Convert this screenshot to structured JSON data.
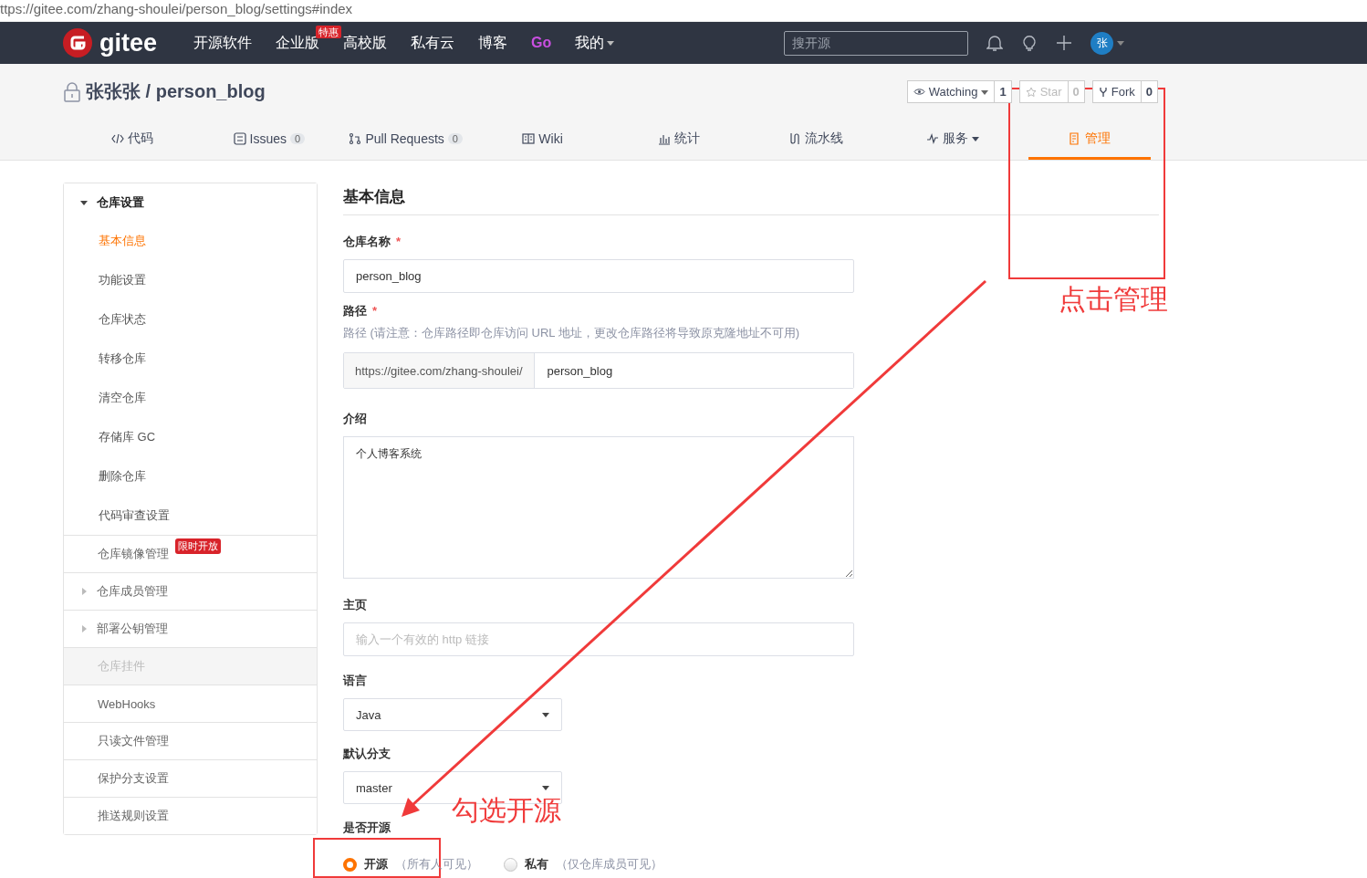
{
  "address_bar": {
    "url": "ttps://gitee.com/zhang-shoulei/person_blog/settings#index"
  },
  "navbar": {
    "logo": "gitee",
    "items": [
      {
        "label": "开源软件",
        "kind": "text"
      },
      {
        "label": "企业版",
        "kind": "text",
        "badge": "特惠"
      },
      {
        "label": "高校版",
        "kind": "text"
      },
      {
        "label": "私有云",
        "kind": "text"
      },
      {
        "label": "博客",
        "kind": "text"
      },
      {
        "label": "Go",
        "kind": "brand"
      },
      {
        "label": "我的",
        "kind": "menu"
      }
    ],
    "search": {
      "placeholder": "搜开源"
    },
    "avatar": "张"
  },
  "repo": {
    "owner": "张张张",
    "separator": "/",
    "name": "person_blog",
    "buttons": [
      {
        "label": "Watching",
        "count": "1",
        "disabled": false,
        "kind": "watch"
      },
      {
        "label": "Star",
        "count": "0",
        "disabled": true,
        "kind": "star"
      },
      {
        "label": "Fork",
        "count": "0",
        "disabled": false,
        "kind": "fork"
      }
    ],
    "tabs": [
      {
        "label": "代码",
        "selected": false
      },
      {
        "label": "Issues",
        "count": "0",
        "selected": false
      },
      {
        "label": "Pull Requests",
        "count": "0",
        "selected": false
      },
      {
        "label": "Wiki",
        "selected": false
      },
      {
        "label": "统计",
        "selected": false
      },
      {
        "label": "流水线",
        "selected": false
      },
      {
        "label": "服务",
        "dropdown": true,
        "selected": false
      },
      {
        "label": "管理",
        "selected": true
      }
    ]
  },
  "sidebar": {
    "items": [
      {
        "label": "仓库设置",
        "kind": "group",
        "expanded": true,
        "selected": false,
        "disabled": false,
        "children": [
          {
            "label": "基本信息",
            "selected": true
          },
          {
            "label": "功能设置",
            "selected": false
          },
          {
            "label": "仓库状态",
            "selected": false
          },
          {
            "label": "转移仓库",
            "selected": false
          },
          {
            "label": "清空仓库",
            "selected": false
          },
          {
            "label": "存储库 GC",
            "selected": false
          },
          {
            "label": "删除仓库",
            "selected": false
          },
          {
            "label": "代码审查设置",
            "selected": false
          }
        ]
      },
      {
        "label": "仓库镜像管理",
        "kind": "item",
        "badge": "限时开放",
        "selected": false,
        "disabled": false
      },
      {
        "label": "仓库成员管理",
        "kind": "group",
        "expanded": false,
        "selected": false,
        "disabled": false
      },
      {
        "label": "部署公钥管理",
        "kind": "group",
        "expanded": false,
        "selected": false,
        "disabled": false
      },
      {
        "label": "仓库挂件",
        "kind": "item",
        "selected": false,
        "disabled": true
      },
      {
        "label": "WebHooks",
        "kind": "item",
        "selected": false,
        "disabled": false
      },
      {
        "label": "只读文件管理",
        "kind": "item",
        "selected": false,
        "disabled": false
      },
      {
        "label": "保护分支设置",
        "kind": "item",
        "selected": false,
        "disabled": false
      },
      {
        "label": "推送规则设置",
        "kind": "item",
        "selected": false,
        "disabled": false
      }
    ]
  },
  "form": {
    "title": "基本信息",
    "fields": [
      {
        "kind": "input",
        "label": "仓库名称",
        "required_mark": "*",
        "value": "person_blog"
      },
      {
        "kind": "prefixed",
        "label": "路径",
        "required_mark": "*",
        "hint": "路径 (请注意：仓库路径即仓库访问 URL 地址，更改仓库路径将导致原克隆地址不可用)",
        "prefix": "https://gitee.com/zhang-shoulei/",
        "value": "person_blog"
      },
      {
        "kind": "textarea",
        "label": "介绍",
        "value": "个人博客系统"
      },
      {
        "kind": "input",
        "label": "主页",
        "placeholder": "输入一个有效的 http 链接"
      },
      {
        "kind": "select",
        "label": "语言",
        "value": "Java"
      },
      {
        "kind": "select",
        "label": "默认分支",
        "value": "master"
      },
      {
        "kind": "radio",
        "label": "是否开源",
        "options": [
          {
            "label": "开源",
            "note": "（所有人可见）",
            "selected": true
          },
          {
            "label": "私有",
            "note": "（仅仓库成员可见）",
            "selected": false
          }
        ]
      }
    ]
  },
  "annotations": [
    {
      "text": "点击管理"
    },
    {
      "text": "勾选开源"
    }
  ]
}
